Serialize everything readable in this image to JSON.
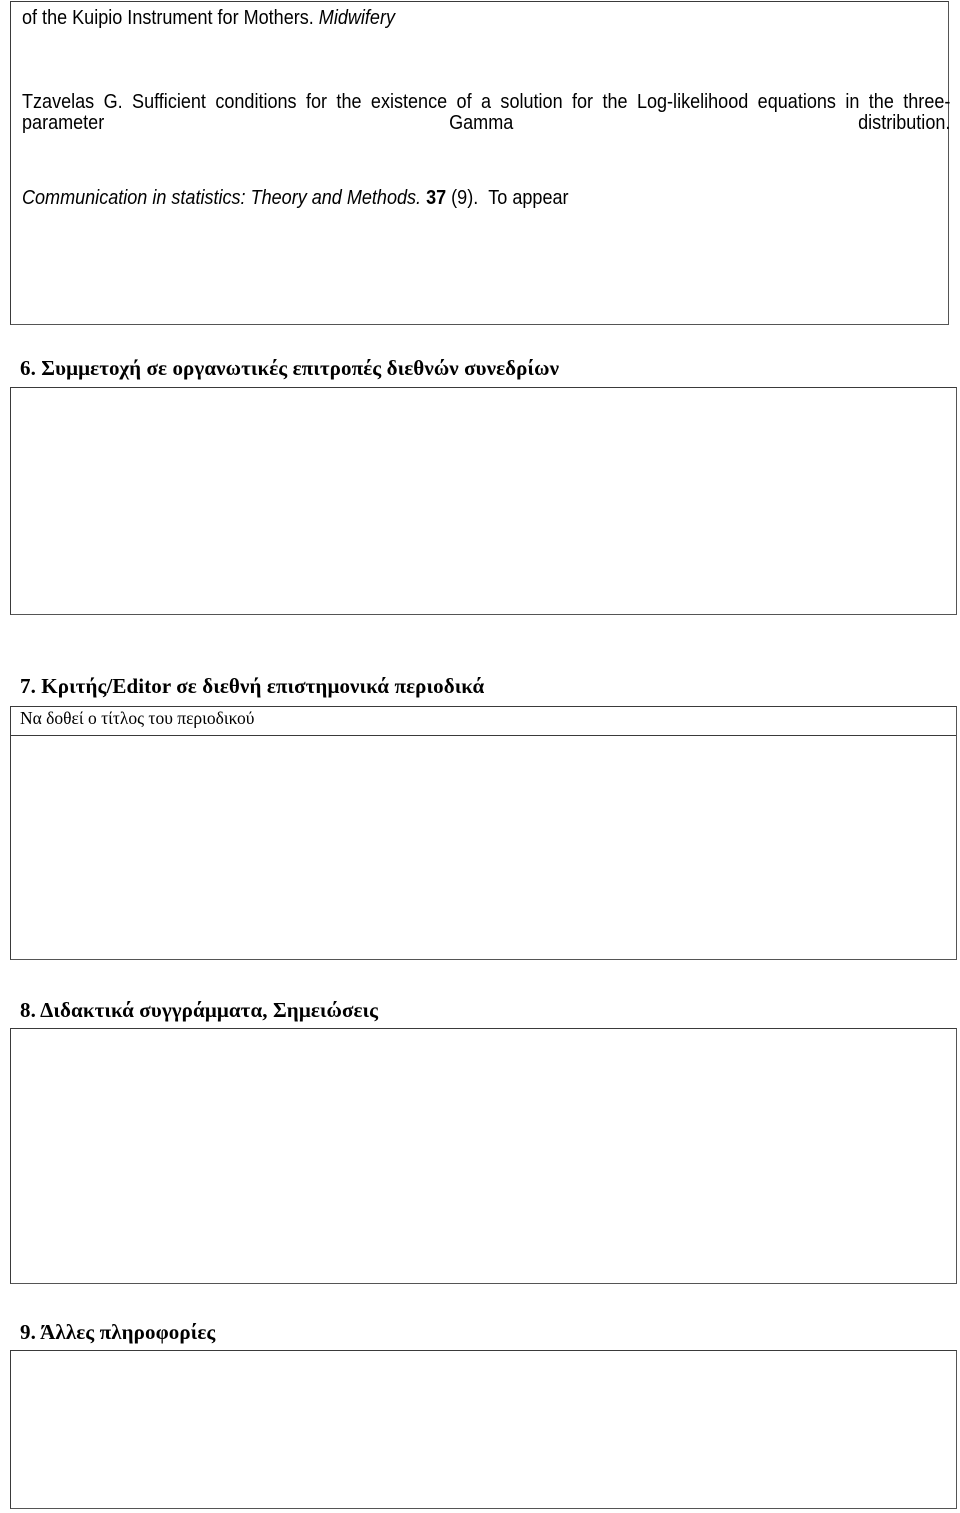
{
  "document": {
    "language": "el-GR",
    "type": "academic-cv-form"
  },
  "publications": {
    "entry_1_line": "of the Kuipio Instrument for Mothers.",
    "entry_1_journal": "Midwifery",
    "entry_2_text": "Tzavelas G. Sufficient conditions for the existence of a solution for the Log-likelihood equations in the three-parameter Gamma distribution.",
    "entry_2_journal": "Communication in statistics: Theory and Methods.",
    "entry_2_volume": "37",
    "entry_2_issue": "(9).",
    "entry_2_status": "To appear"
  },
  "sections": [
    {
      "number": "6.",
      "title": "Συμμετοχή σε οργανωτικές επιτροπές διεθνών συνεδρίων",
      "heading_full": "6. Συμμετοχή σε οργανωτικές επιτροπές διεθνών συνεδρίων",
      "body": "",
      "has_subheader": false
    },
    {
      "number": "7.",
      "title": "Κριτής/Editor σε διεθνή επιστημονικά περιοδικά",
      "heading_full": "7. Κριτής/Editor σε διεθνή επιστημονικά περιοδικά",
      "subheader": "Να δοθεί ο τίτλος του περιοδικού",
      "body": "",
      "has_subheader": true
    },
    {
      "number": "8.",
      "title": "Διδακτικά συγγράμματα, Σημειώσεις",
      "heading_full": "8. Διδακτικά συγγράμματα, Σημειώσεις",
      "body": "",
      "has_subheader": false
    },
    {
      "number": "9.",
      "title": "Άλλες πληροφορίες",
      "heading_full": "9. Άλλες πληροφορίες",
      "body": "",
      "has_subheader": false
    }
  ],
  "colors": {
    "page_background": "#ffffff",
    "text": "#000000",
    "border": "#3a3a3a",
    "border_shadow": "#555555"
  }
}
